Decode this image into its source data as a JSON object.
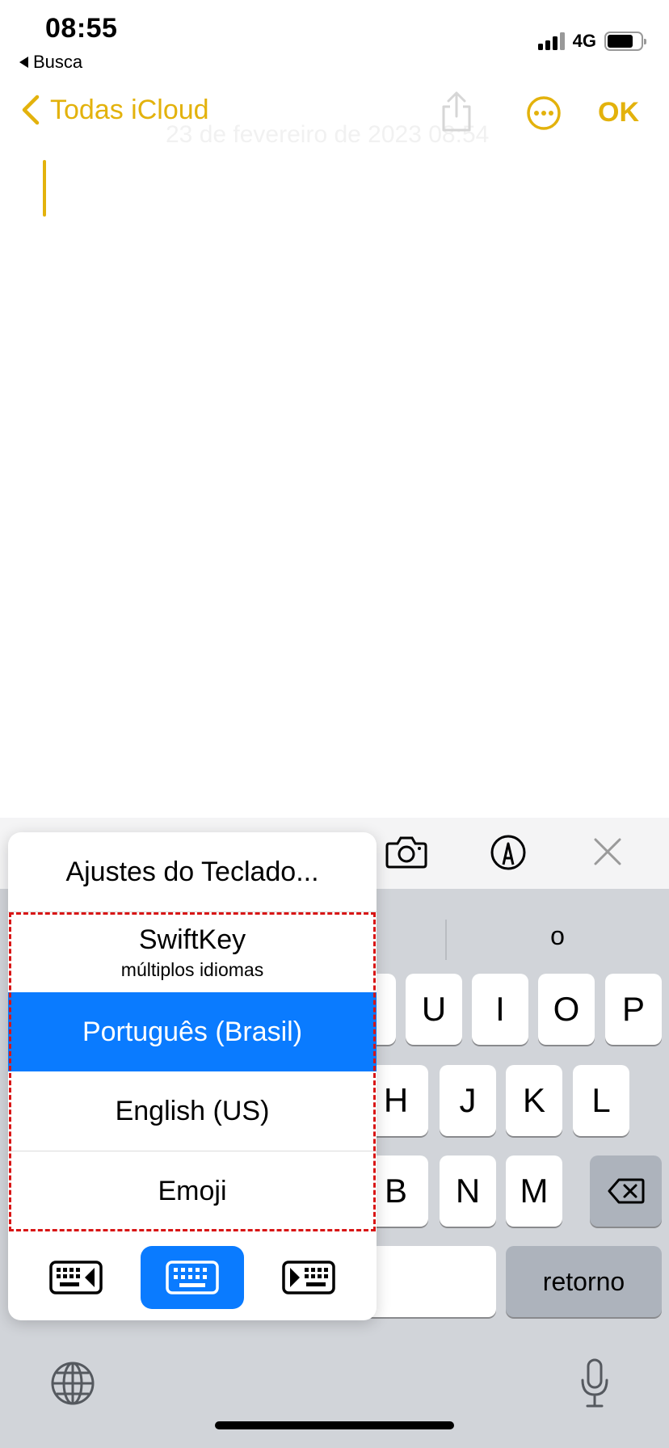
{
  "status": {
    "time": "08:55",
    "back_app": "Busca",
    "network": "4G",
    "battery_level": 0.78
  },
  "nav": {
    "back_label": "Todas iCloud",
    "date_text": "23 de fevereiro de 2023 08:54",
    "ok_label": "OK"
  },
  "toolbar": {
    "icons": [
      "camera-icon",
      "markup-pen-icon",
      "close-icon"
    ]
  },
  "predictions": [
    "o"
  ],
  "keyboard": {
    "row1": [
      "U",
      "I",
      "O",
      "P"
    ],
    "row2": [
      "H",
      "J",
      "K",
      "L"
    ],
    "row3": [
      "B",
      "N",
      "M"
    ],
    "return_label": "retorno"
  },
  "keyboard_menu": {
    "settings_label": "Ajustes do Teclado...",
    "items": [
      {
        "title": "SwiftKey",
        "subtitle": "múltiplos idiomas"
      },
      {
        "title": "Português (Brasil)",
        "selected": true
      },
      {
        "title": "English (US)"
      },
      {
        "title": "Emoji"
      }
    ],
    "layout_buttons": [
      "keyboard-left-icon",
      "keyboard-full-icon",
      "keyboard-right-icon"
    ]
  },
  "colors": {
    "accent": "#e3b20c",
    "selection": "#0a7bff",
    "highlight_border": "#d81515"
  }
}
